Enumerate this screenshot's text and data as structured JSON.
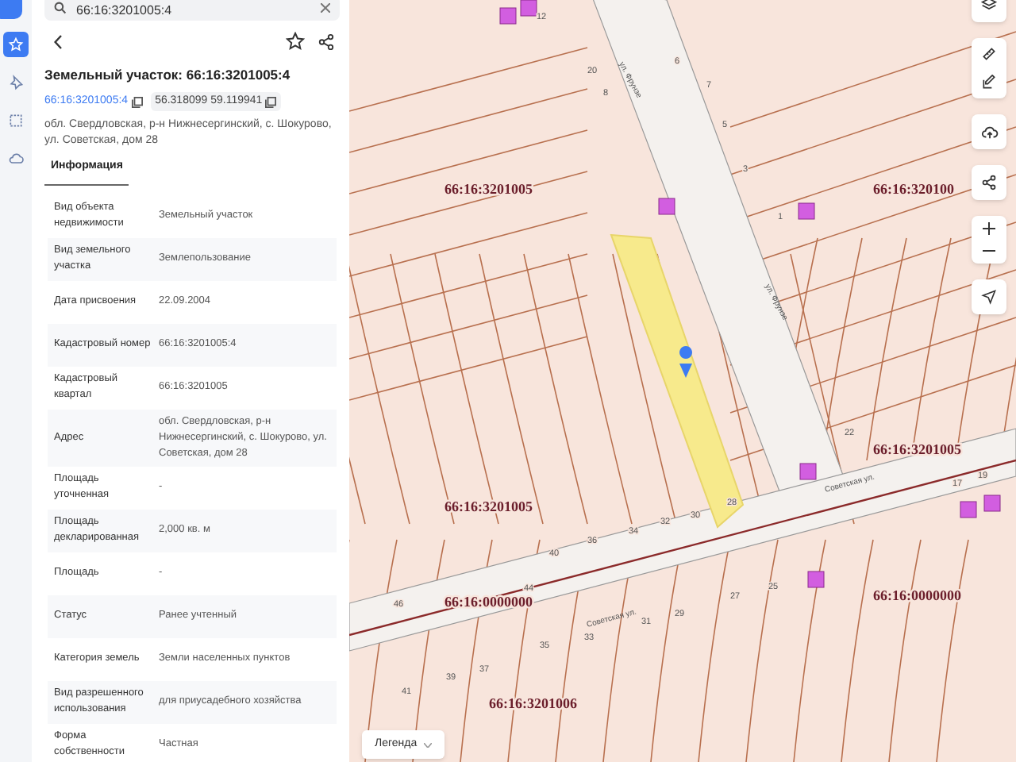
{
  "search": {
    "value": "66:16:3201005:4"
  },
  "card": {
    "title": "Земельный участок: 66:16:3201005:4",
    "cadastral_link": "66:16:3201005:4",
    "coordinates": "56.318099 59.119941",
    "address": "обл. Свердловская, р-н Нижнесергинский, с. Шокурово, ул. Советская, дом 28"
  },
  "tabs": [
    {
      "label": "Информация",
      "selected": true
    }
  ],
  "rail": [
    {
      "selected": true
    },
    {
      "selected": false
    },
    {
      "selected": false
    },
    {
      "selected": false
    }
  ],
  "info_rows": [
    {
      "label": "Вид объекта недвижимости",
      "value": "Земельный участок"
    },
    {
      "label": "Вид земельного участка",
      "value": "Землепользование"
    },
    {
      "label": "Дата присвоения",
      "value": "22.09.2004"
    },
    {
      "label": "Кадастровый номер",
      "value": "66:16:3201005:4"
    },
    {
      "label": "Кадастровый квартал",
      "value": "66:16:3201005"
    },
    {
      "label": "Адрес",
      "value": "обл. Свердловская, р-н Нижнесергинский, с. Шокурово, ул. Советская, дом 28"
    },
    {
      "label": "Площадь уточненная",
      "value": "-"
    },
    {
      "label": "Площадь декларированная",
      "value": "2,000 кв. м"
    },
    {
      "label": "Площадь",
      "value": "-"
    },
    {
      "label": "Статус",
      "value": "Ранее учтенный"
    },
    {
      "label": "Категория земель",
      "value": "Земли населенных пунктов"
    },
    {
      "label": "Вид разрешенного использования",
      "value": "для приусадебного хозяйства"
    },
    {
      "label": "Форма собственности",
      "value": "Частная"
    }
  ],
  "map": {
    "quarter_labels": [
      "66:16:3201005",
      "66:16:320100",
      "66:16:3201005",
      "66:16:3201005",
      "66:16:0000000",
      "66:16:0000000",
      "66:16:3201006"
    ],
    "street_labels": [
      "ул. Фрунзе",
      "ул. Фрунзе",
      "Советская ул.",
      "Советская ул."
    ],
    "house_numbers": [
      "12",
      "20",
      "8",
      "6",
      "7",
      "5",
      "3",
      "1",
      "28",
      "30",
      "32",
      "34",
      "36",
      "40",
      "44",
      "46",
      "22",
      "19",
      "17",
      "25",
      "27",
      "29",
      "31",
      "33",
      "35",
      "37",
      "39",
      "41"
    ],
    "legend_button": "Легенда"
  }
}
